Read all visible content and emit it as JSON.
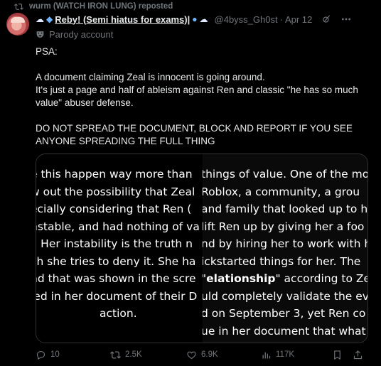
{
  "repost": {
    "text": "wurm (WATCH IRON LUNG) reposted"
  },
  "author": {
    "display_name": "Reby! (Semi hiatus for exams)|",
    "handle": "@4byss_Gh0st",
    "dot": "·",
    "date": "Apr 12",
    "parody_label": "Parody account"
  },
  "tweet": {
    "line1": "PSA:",
    "line2": "A document claiming Zeal is innocent is going around.",
    "line3": "It's just a page and half of ableism against Ren and classic \"he has so much value\" abuser defense.",
    "line4": "DO NOT SPREAD THE DOCUMENT, BLOCK AND REPORT IF YOU SEE ANYONE SPREADING THE FULL THING"
  },
  "document": {
    "left_lines": [
      "e this happen way more than",
      "w out the possibility that Zeal",
      "ecially considering that Ren (",
      "nstable, and had nothing of va",
      "l. Her instability is the truth n",
      "ch she tries to deny it. She ha",
      "nd that was shown in the scre",
      "led in her document of their D",
      "action."
    ],
    "right_lines": [
      "things of value. One of the mo",
      "Roblox, a community, a grou",
      "and family that looked up to h",
      "lift Ren up by giving her a foo",
      "nd by hiring her to work with h",
      "ickstarted things for her. The",
      "\"",
      "uld completely validate the ev",
      "d on September 3, yet Ren co",
      "ue in her document that what"
    ],
    "right_line7_bold": "elationship",
    "right_line7_rest": "\" according to Zea"
  },
  "actions": {
    "replies": "10",
    "reposts": "2.5K",
    "likes": "6.9K",
    "views": "117K"
  },
  "colors": {
    "background": "#000000",
    "text": "#e7e9ea",
    "muted": "#71767b",
    "border": "#2f3336"
  },
  "icons": {
    "repost": "repost-icon",
    "parody": "parody-mask-icon",
    "grok": "grok-icon",
    "more": "more-icon",
    "reply": "reply-icon",
    "like": "heart-icon",
    "views": "views-icon",
    "bookmark": "bookmark-icon",
    "share": "share-icon"
  }
}
